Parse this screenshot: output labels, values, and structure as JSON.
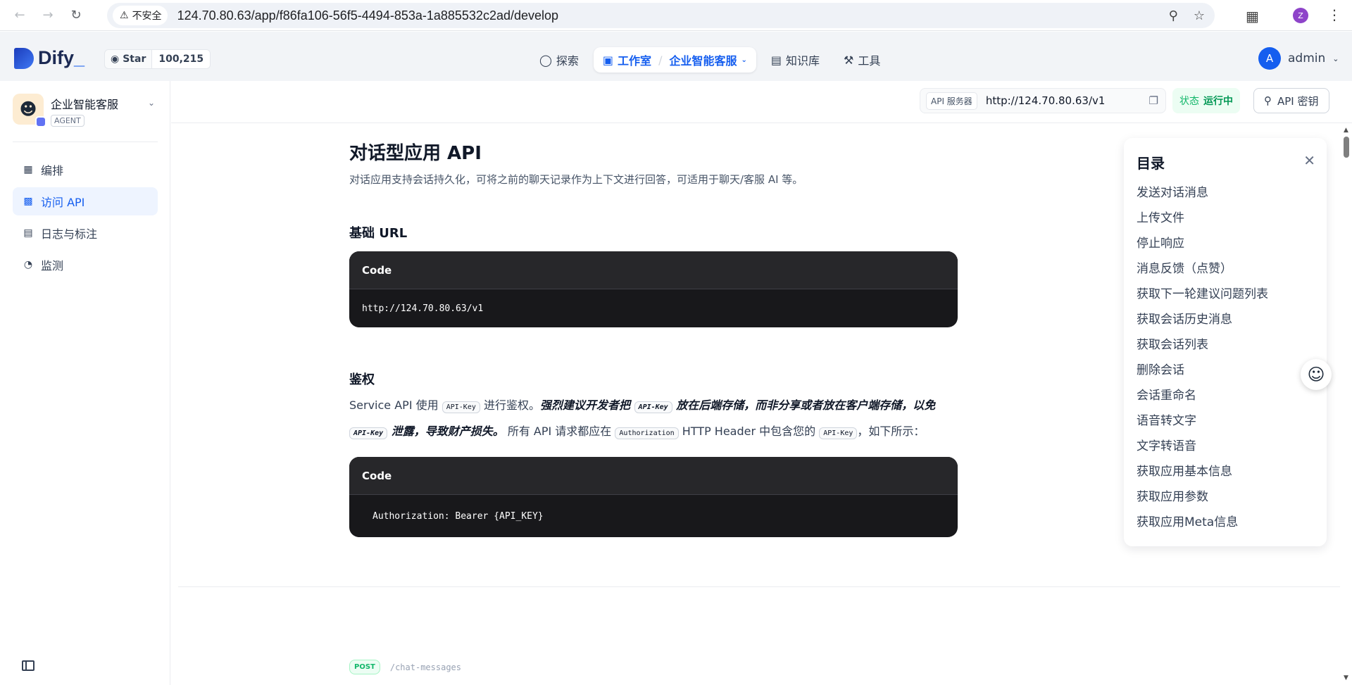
{
  "browser": {
    "insecure_label": "不安全",
    "url": "124.70.80.63/app/f86fa106-56f5-4494-853a-1a885532c2ad/develop",
    "profile_initial": "Z"
  },
  "header": {
    "logo_text": "Dify",
    "github_star_label": "Star",
    "github_star_count": "100,215",
    "nav": {
      "explore": "探索",
      "studio": "工作室",
      "current_app": "企业智能客服",
      "knowledge": "知识库",
      "tools": "工具"
    },
    "user_initial": "A",
    "user_name": "admin"
  },
  "sidebar": {
    "app_name": "企业智能客服",
    "app_type": "AGENT",
    "items": [
      {
        "label": "编排",
        "icon": "layout-icon"
      },
      {
        "label": "访问 API",
        "icon": "terminal-icon"
      },
      {
        "label": "日志与标注",
        "icon": "file-list-icon"
      },
      {
        "label": "监测",
        "icon": "dashboard-icon"
      }
    ]
  },
  "api_bar": {
    "server_tag": "API 服务器",
    "server_url": "http://124.70.80.63/v1",
    "status_label": "状态",
    "status_value": "运行中",
    "api_key_button": "API 密钥"
  },
  "doc": {
    "title": "对话型应用 API",
    "subtitle": "对话应用支持会话持久化，可将之前的聊天记录作为上下文进行回答，可适用于聊天/客服 AI 等。",
    "base_url_heading": "基础 URL",
    "code_label": "Code",
    "base_url_code": "http://124.70.80.63/v1",
    "auth_heading": "鉴权",
    "auth_text": {
      "p1": "Service API 使用 ",
      "code_api_key": "API-Key",
      "p2": " 进行鉴权。",
      "strong1": "强烈建议开发者把 ",
      "strong2": " 放在后端存储，而非分享或者放在客户端存储，以免 ",
      "strong3": " 泄露，导致财产损失。",
      "p3": " 所有 API 请求都应在 ",
      "code_authorization": "Authorization",
      "p4": " HTTP Header 中包含您的 ",
      "p5": "，如下所示："
    },
    "auth_code": "Authorization: Bearer {API_KEY}",
    "endpoint_method": "POST",
    "endpoint_path": "/chat-messages"
  },
  "toc": {
    "title": "目录",
    "items": [
      "发送对话消息",
      "上传文件",
      "停止响应",
      "消息反馈（点赞）",
      "获取下一轮建议问题列表",
      "获取会话历史消息",
      "获取会话列表",
      "删除会话",
      "会话重命名",
      "语音转文字",
      "文字转语音",
      "获取应用基本信息",
      "获取应用参数",
      "获取应用Meta信息"
    ]
  }
}
